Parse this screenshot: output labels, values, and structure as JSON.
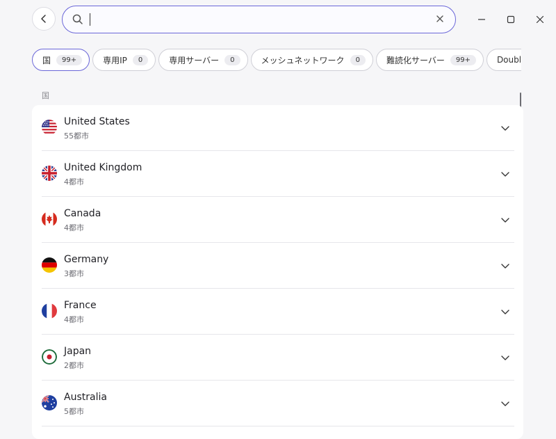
{
  "search": {
    "value": "",
    "placeholder": ""
  },
  "filters": [
    {
      "label": "国",
      "count": "99+"
    },
    {
      "label": "専用IP",
      "count": "0"
    },
    {
      "label": "専用サーバー",
      "count": "0"
    },
    {
      "label": "メッシュネットワーク",
      "count": "0"
    },
    {
      "label": "難読化サーバー",
      "count": "99+"
    },
    {
      "label": "Double VP"
    }
  ],
  "section_label": "国",
  "countries": [
    {
      "name": "United States",
      "cities": "55都市"
    },
    {
      "name": "United Kingdom",
      "cities": "4都市"
    },
    {
      "name": "Canada",
      "cities": "4都市"
    },
    {
      "name": "Germany",
      "cities": "3都市"
    },
    {
      "name": "France",
      "cities": "4都市"
    },
    {
      "name": "Japan",
      "cities": "2都市"
    },
    {
      "name": "Australia",
      "cities": "5都市"
    }
  ],
  "icons": {
    "back": "chevron-left-icon",
    "search": "search-icon",
    "clear": "close-icon",
    "expand": "chevron-down-icon"
  }
}
